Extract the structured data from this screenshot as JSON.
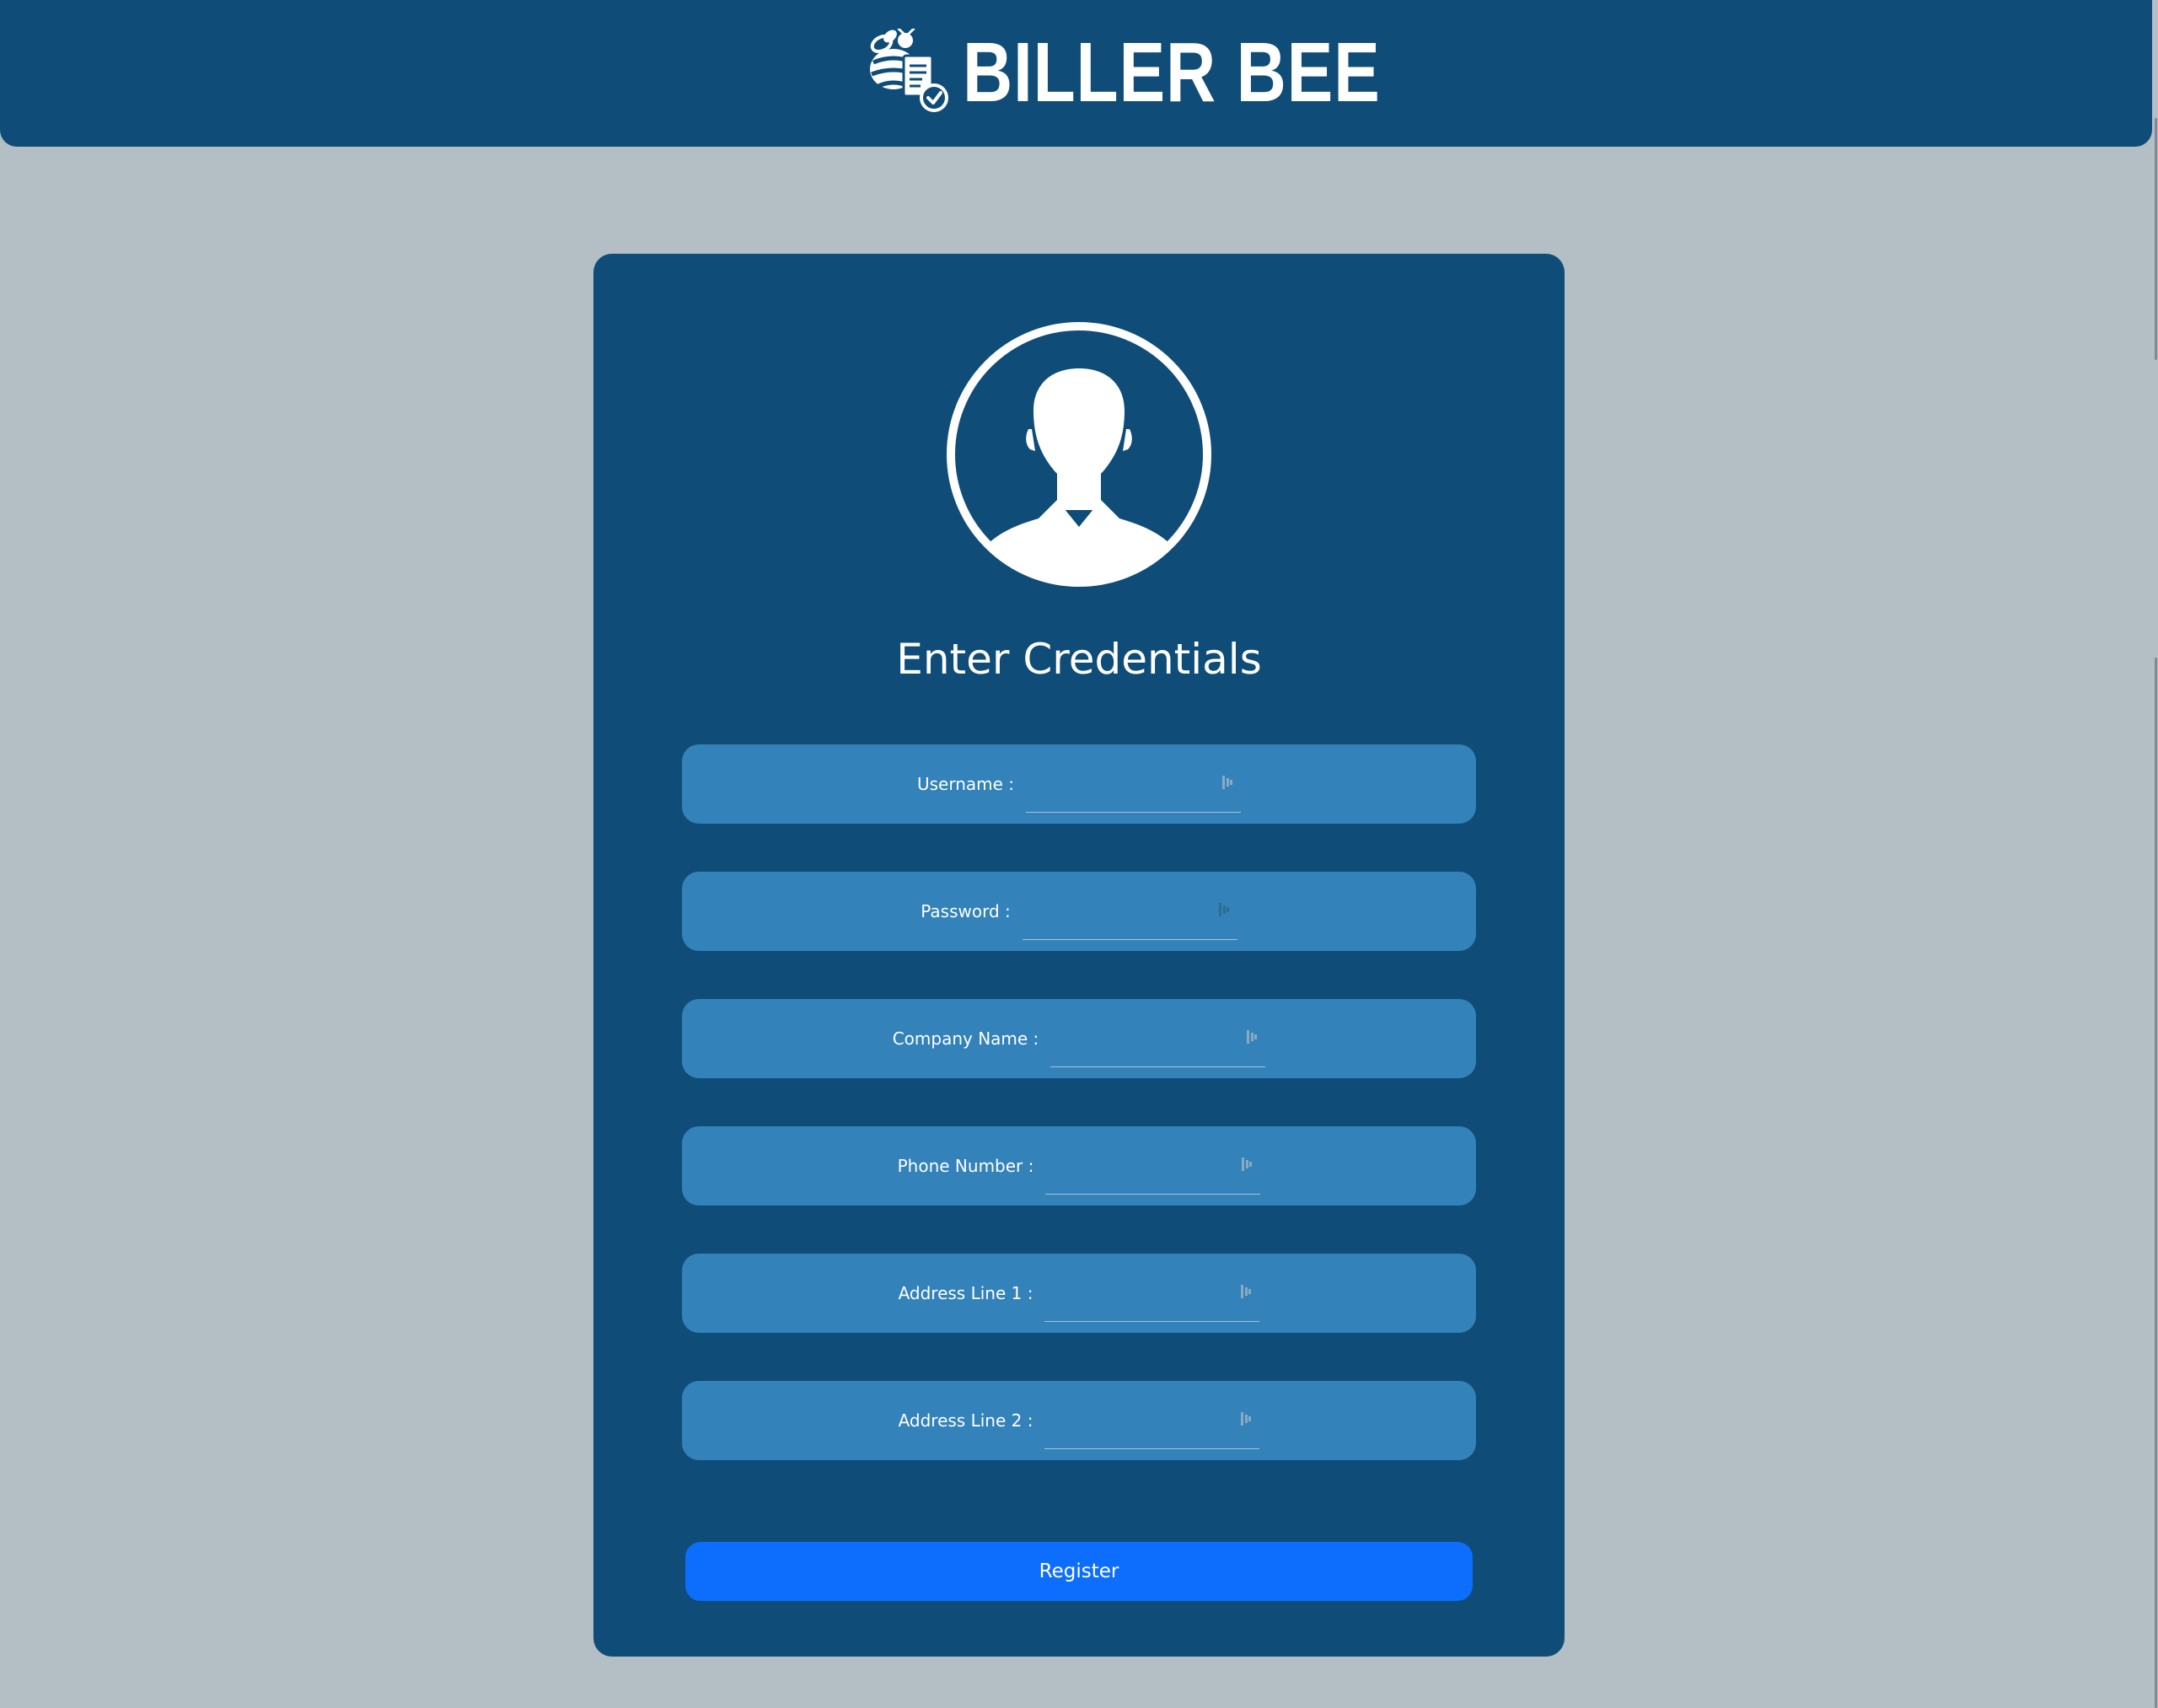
{
  "header": {
    "brand_name": "BILLER BEE",
    "logo_icon": "bee-invoice-icon"
  },
  "form": {
    "avatar_icon": "user-avatar-icon",
    "title": "Enter Credentials",
    "fields": [
      {
        "label": "Username :",
        "value": "",
        "placeholder": ""
      },
      {
        "label": "Password :",
        "value": "",
        "placeholder": ""
      },
      {
        "label": "Company Name :",
        "value": "",
        "placeholder": ""
      },
      {
        "label": "Phone Number :",
        "value": "",
        "placeholder": ""
      },
      {
        "label": "Address Line 1 :",
        "value": "",
        "placeholder": ""
      },
      {
        "label": "Address Line 2 :",
        "value": "",
        "placeholder": ""
      }
    ],
    "submit_label": "Register"
  },
  "colors": {
    "page_background": "#b3bec5",
    "header_background": "#0f4c77",
    "card_background": "#0f4c77",
    "field_background": "#3382ba",
    "primary_button": "#0d6efd",
    "text": "#ffffff"
  }
}
